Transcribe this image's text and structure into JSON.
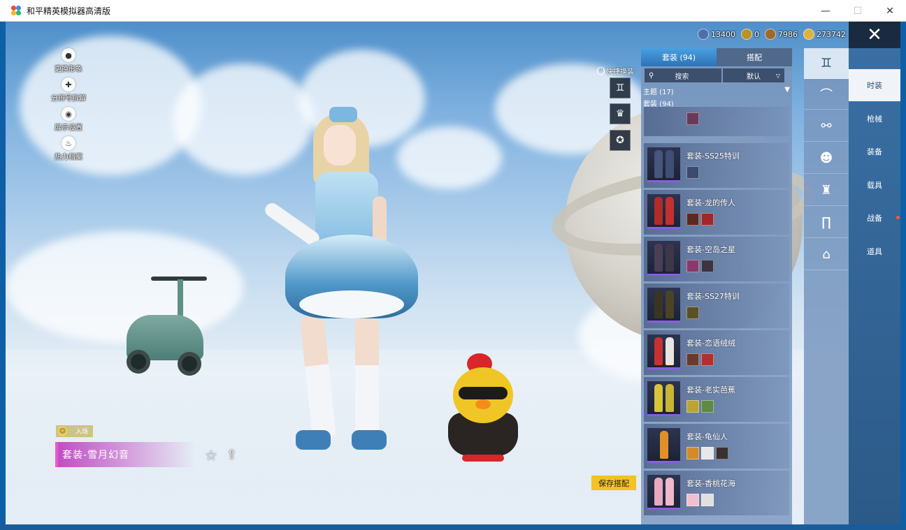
{
  "window": {
    "title": "和平精英模拟器高清版",
    "minimize": "—",
    "maximize": "☐",
    "close": "✕"
  },
  "colors": {
    "accent_tab": "#2c73b4",
    "save_button": "#f2c321",
    "outfit_label": "#e55cc7"
  },
  "left_menu": [
    {
      "label": "更换形象",
      "icon": "avatar-icon"
    },
    {
      "label": "分辨号拆解",
      "icon": "puzzle-icon"
    },
    {
      "label": "展示设置",
      "icon": "eye-icon"
    },
    {
      "label": "热力档案",
      "icon": "flame-icon"
    }
  ],
  "currencies": [
    {
      "icon": "coin-blue-icon",
      "value": "13400"
    },
    {
      "icon": "coin-gold-ring-icon",
      "value": "0"
    },
    {
      "icon": "coin-bronze-icon",
      "value": "7986"
    },
    {
      "icon": "coin-gold-icon",
      "value": "273742"
    }
  ],
  "close_game": "✕",
  "quick_change": {
    "label": "快捷换装",
    "help": "?"
  },
  "entry_badge": {
    "label": "入场"
  },
  "outfit_name": "套装-雪月幻音",
  "save_button": "保存搭配",
  "panel": {
    "tabs": [
      {
        "label": "套装 (94)",
        "active": true
      },
      {
        "label": "搭配",
        "active": false
      }
    ],
    "search_placeholder": "搜索",
    "sort_label": "默认",
    "theme_label": "主题 (17)",
    "suit_count": "套装 (94)",
    "items": [
      {
        "name": "套装-SS25特训"
      },
      {
        "name": "套装-龙的传人"
      },
      {
        "name": "套装-空岛之星"
      },
      {
        "name": "套装-SS27特训"
      },
      {
        "name": "套装-恋语绒绒"
      },
      {
        "name": "套装-老实芭蕉"
      },
      {
        "name": "套装-龟仙人"
      },
      {
        "name": "套装-香桃花海"
      }
    ]
  },
  "main_tabs": [
    {
      "label": "时装",
      "active": true
    },
    {
      "label": "枪械",
      "active": false
    },
    {
      "label": "装备",
      "active": false
    },
    {
      "label": "载具",
      "active": false
    },
    {
      "label": "战备",
      "active": false
    },
    {
      "label": "道具",
      "active": false
    }
  ],
  "category_icons": [
    "outfit-icon",
    "hat-icon",
    "glasses-icon",
    "mask-icon",
    "top-icon",
    "pants-icon",
    "shoes-icon"
  ]
}
